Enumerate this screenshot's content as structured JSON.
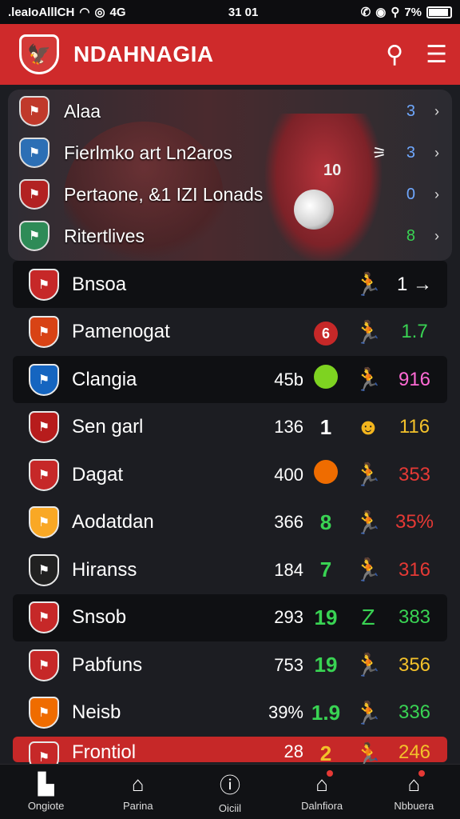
{
  "status": {
    "left": ".leaIoAlllCH",
    "network": "4G",
    "time": "31 01",
    "battery": "7%"
  },
  "header": {
    "title": "NDAHNAGIA"
  },
  "hero_rows": [
    {
      "label": "Alaa",
      "value": "3",
      "arrow": "›",
      "value_color": "#6fa8ff"
    },
    {
      "label": "Fierlmko art Ln2aros",
      "value": "3",
      "arrow": "›",
      "icon": "⚞",
      "value_color": "#6fa8ff"
    },
    {
      "label": "Pertaone, &1 IZI Lonads",
      "value": "0",
      "arrow": "›",
      "value_color": "#6fa8ff"
    },
    {
      "label": "Ritertlives",
      "value": "8",
      "arrow": "›",
      "value_color": "#39d353"
    }
  ],
  "rows": [
    {
      "name": "Bnsoa",
      "c1": "",
      "c2": "",
      "c3": "🏃",
      "c3_color": "#39d353",
      "c4": "1 →",
      "c4_color": "#ffffff",
      "dark": true
    },
    {
      "name": "Pamenogat",
      "c1": "",
      "c2": "6",
      "c2_style": "red-dot",
      "c3": "🏃",
      "c3_color": "#3a8be0",
      "c4": "1.7",
      "c4_color": "#39d353",
      "dark": false
    },
    {
      "name": "Clangia",
      "c1": "45b",
      "c2": "",
      "c2_style": "green-dot",
      "c3": "🏃",
      "c3_color": "#ff6ad5",
      "c4": "916",
      "c4_color": "#ff6ad5",
      "dark": true
    },
    {
      "name": "Sen garl",
      "c1": "136",
      "c2": "1",
      "c3": "☻",
      "c3_color": "#f3b51d",
      "c4": "116",
      "c4_color": "#f3c12a",
      "dark": false
    },
    {
      "name": "Dagat",
      "c1": "400",
      "c2": "",
      "c2_style": "orange-dot",
      "c3": "🏃",
      "c3_color": "#3a8be0",
      "c4": "353",
      "c4_color": "#e53935",
      "dark": false
    },
    {
      "name": "Aodatdan",
      "c1": "366",
      "c2": "8",
      "c2_color": "#39d353",
      "c3": "🏃",
      "c3_color": "#39d353",
      "c4": "35%",
      "c4_color": "#e53935",
      "dark": false
    },
    {
      "name": "Hiranss",
      "c1": "184",
      "c2": "7",
      "c2_color": "#39d353",
      "c3": "🏃",
      "c3_color": "#f3a91d",
      "c4": "316",
      "c4_color": "#e53935",
      "dark": false
    },
    {
      "name": "Snsob",
      "c1": "293",
      "c2": "19",
      "c2_color": "#39d353",
      "c3": "Z",
      "c3_color": "#39d353",
      "c4": "383",
      "c4_color": "#39d353",
      "dark": true
    },
    {
      "name": "Pabfuns",
      "c1": "753",
      "c2": "19",
      "c2_color": "#39d353",
      "c3": "🏃",
      "c3_color": "#3a8be0",
      "c4": "356",
      "c4_color": "#f3c12a",
      "dark": false
    },
    {
      "name": "Neisb",
      "c1": "39%",
      "c2": "1.9",
      "c2_color": "#39d353",
      "c3": "🏃",
      "c3_color": "#39d353",
      "c4": "336",
      "c4_color": "#39d353",
      "dark": false
    },
    {
      "name": "Frontiol",
      "c1": "28",
      "c2": "2",
      "c2_color": "#f3c12a",
      "c3": "🏃",
      "c3_color": "#f3c12a",
      "c4": "246",
      "c4_color": "#f3c12a",
      "dark": false,
      "highlight": true
    }
  ],
  "nav": [
    {
      "label": "Ongiote",
      "icon": "home-icon"
    },
    {
      "label": "Parina",
      "icon": "stadium-icon"
    },
    {
      "label": "Oiciil",
      "icon": "info-icon"
    },
    {
      "label": "Dalnfiora",
      "icon": "shop-icon",
      "notif": true
    },
    {
      "label": "Nbbuera",
      "icon": "profile-icon",
      "notif": true
    }
  ]
}
